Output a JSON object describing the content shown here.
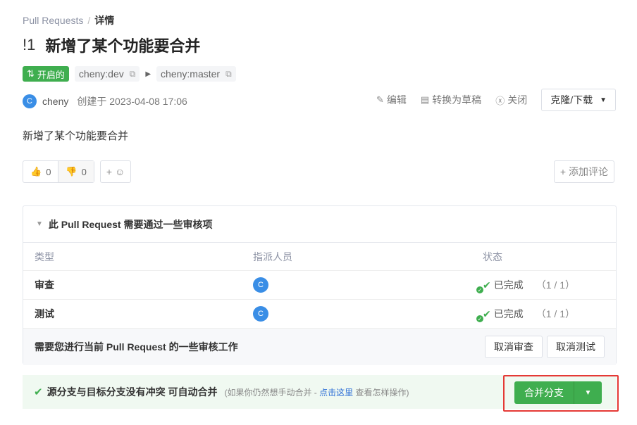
{
  "breadcrumb": {
    "parent": "Pull Requests",
    "separator": "/",
    "current": "详情"
  },
  "pr": {
    "number": "!1",
    "title": "新增了某个功能要合并"
  },
  "status": {
    "label": "开启的",
    "icon": "pull-request-icon",
    "color": "#3fae4f"
  },
  "branches": {
    "source": "cheny:dev",
    "target": "cheny:master"
  },
  "meta": {
    "avatar_letter": "C",
    "author": "cheny",
    "created": "创建于 2023-04-08 17:06"
  },
  "actions": {
    "edit": "编辑",
    "draft": "转换为草稿",
    "close": "关闭",
    "clone": "克隆/下载"
  },
  "description": "新增了某个功能要合并",
  "reactions": {
    "up": "0",
    "down": "0",
    "emoji_plus": "+"
  },
  "add_comment": "+ 添加评论",
  "review": {
    "title": "此 Pull Request 需要通过一些审核项",
    "columns": [
      "类型",
      "指派人员",
      "状态"
    ],
    "rows": [
      {
        "type": "审查",
        "assignee": "C",
        "status": "已完成",
        "count": "（1 / 1）"
      },
      {
        "type": "测试",
        "assignee": "C",
        "status": "已完成",
        "count": "（1 / 1）"
      }
    ],
    "footer_text": "需要您进行当前 Pull Request 的一些审核工作",
    "cancel_review": "取消审查",
    "cancel_test": "取消测试"
  },
  "merge": {
    "message": "源分支与目标分支没有冲突 可自动合并",
    "hint_prefix": "(如果你仍然想手动合并 - ",
    "hint_link": "点击这里",
    "hint_suffix": " 查看怎样操作)",
    "button": "合并分支"
  },
  "colors": {
    "accent": "#3fae4f",
    "highlight": "#e53935",
    "link": "#2d6fd6"
  }
}
